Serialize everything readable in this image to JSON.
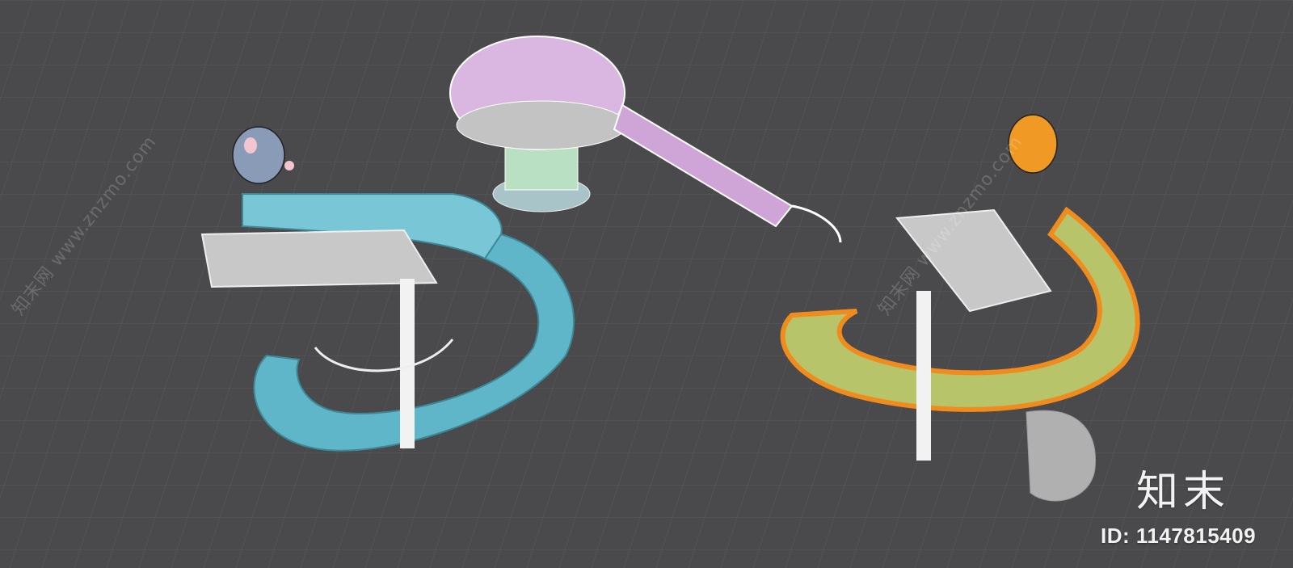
{
  "watermark": {
    "site": "知末网 www.znzmo.com",
    "logo": "知末",
    "id": "ID: 1147815409"
  },
  "scene": {
    "background": "#4a4a4c",
    "grid_color": "#5a5a5d",
    "objects": [
      {
        "name": "blue-mouse-slide",
        "color": "#5fb6c9",
        "head_color": "#8a9bb8"
      },
      {
        "name": "pink-dome-tower",
        "color": "#d9b7e0",
        "base_color": "#a9c4c8"
      },
      {
        "name": "yellow-hamster-slide",
        "color": "#b8c46a",
        "rim_color": "#f08c1e",
        "head_color": "#f09a25"
      }
    ]
  }
}
